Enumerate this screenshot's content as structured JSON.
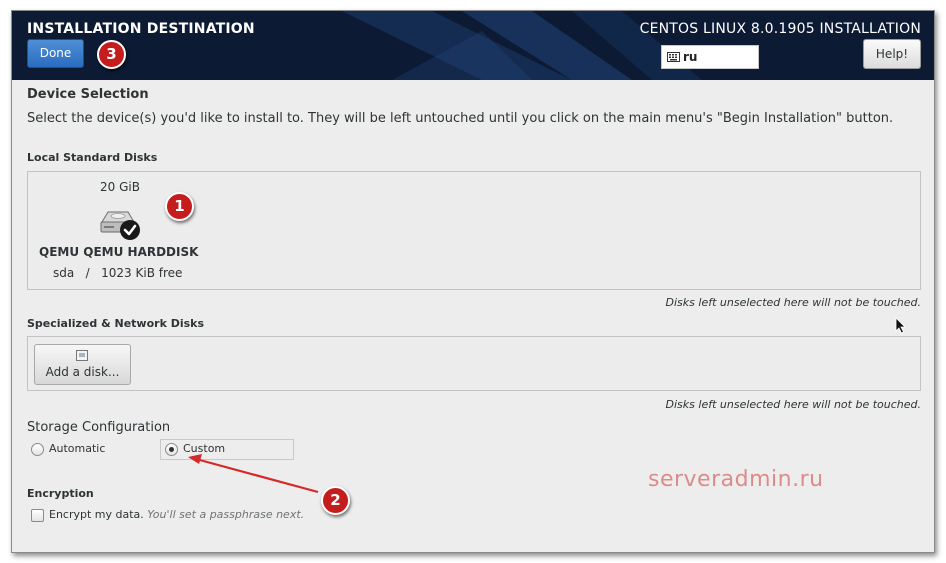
{
  "header": {
    "screen_title": "INSTALLATION DESTINATION",
    "product_title": "CENTOS LINUX 8.0.1905 INSTALLATION",
    "done_label": "Done",
    "keyboard_layout": "ru",
    "help_label": "Help!"
  },
  "device_selection": {
    "heading": "Device Selection",
    "instructions": "Select the device(s) you'd like to install to.  They will be left untouched until you click on the main menu's \"Begin Installation\" button."
  },
  "local_disks": {
    "heading": "Local Standard Disks",
    "disks": [
      {
        "size": "20 GiB",
        "name": "QEMU QEMU HARDDISK",
        "info": "sda   /   1023 KiB free",
        "selected": true
      }
    ],
    "note": "Disks left unselected here will not be touched."
  },
  "specialized_disks": {
    "heading": "Specialized & Network Disks",
    "add_label": "Add a disk...",
    "note": "Disks left unselected here will not be touched."
  },
  "storage": {
    "heading": "Storage Configuration",
    "options": [
      {
        "label": "Automatic",
        "selected": false
      },
      {
        "label": "Custom",
        "selected": true
      }
    ]
  },
  "encryption": {
    "heading": "Encryption",
    "checkbox_label": "Encrypt my data.",
    "hint": "You'll set a passphrase next.",
    "checked": false
  },
  "annotations": {
    "markers": [
      "1",
      "2",
      "3"
    ],
    "watermark": "serveradmin.ru",
    "marker_color": "#c51d1d"
  },
  "colors": {
    "header_bg": "#0c1a33",
    "done_button": "#3a7bd5"
  }
}
